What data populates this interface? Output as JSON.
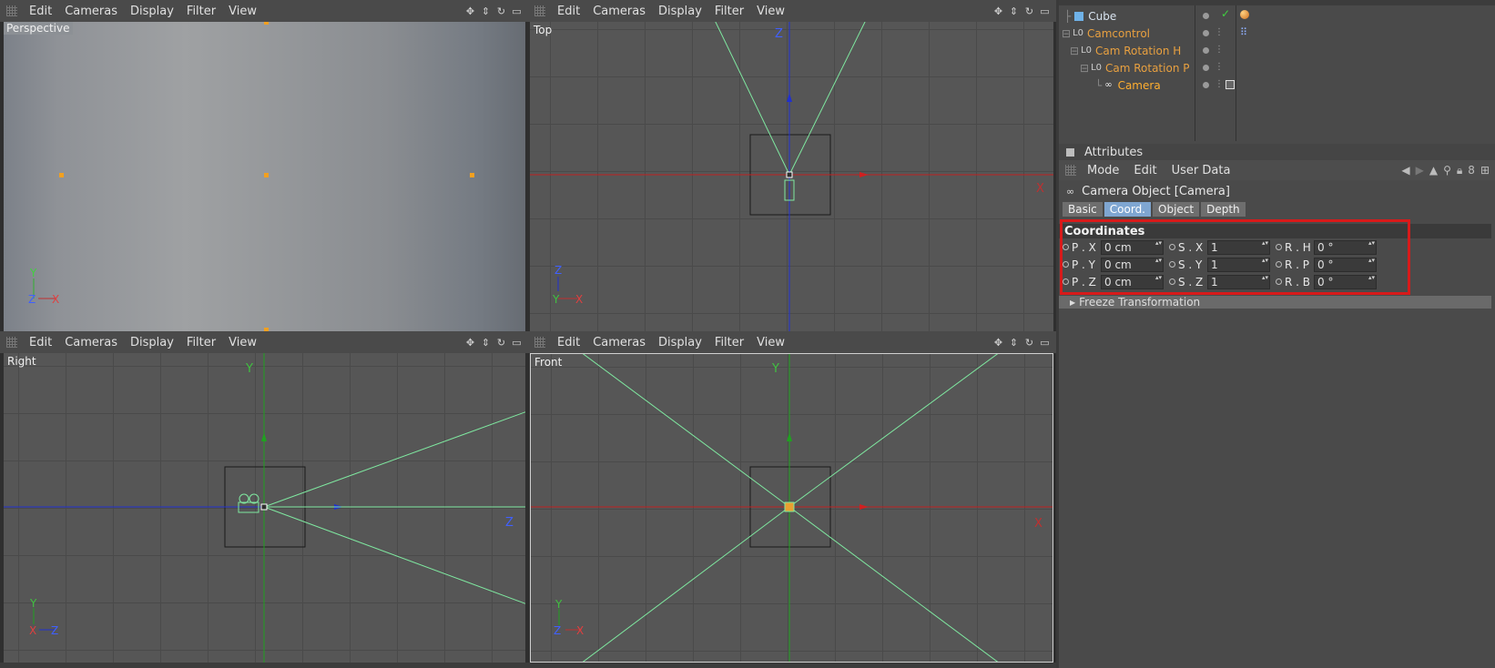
{
  "viewports": {
    "perspective": {
      "label": "Perspective",
      "menu": [
        "Edit",
        "Cameras",
        "Display",
        "Filter",
        "View"
      ],
      "axes": {
        "y": "Y",
        "z": "Z",
        "x": "X"
      }
    },
    "top": {
      "label": "Top",
      "menu": [
        "Edit",
        "Cameras",
        "Display",
        "Filter",
        "View"
      ],
      "axis_a": "Z",
      "axis_b": "X",
      "axes": {
        "z": "Z",
        "y": "Y",
        "x": "X"
      }
    },
    "right": {
      "label": "Right",
      "menu": [
        "Edit",
        "Cameras",
        "Display",
        "Filter",
        "View"
      ],
      "axis_a": "Y",
      "axis_b": "Z",
      "axes": {
        "y": "Y",
        "x": "X",
        "z": "Z"
      }
    },
    "front": {
      "label": "Front",
      "menu": [
        "Edit",
        "Cameras",
        "Display",
        "Filter",
        "View"
      ],
      "axis_a": "Y",
      "axis_b": "X",
      "axes": {
        "y": "Y",
        "z": "Z",
        "x": "X"
      }
    }
  },
  "object_manager": {
    "items": [
      {
        "name": "Cube",
        "style": "blue"
      },
      {
        "name": "Camcontrol",
        "style": "orange"
      },
      {
        "name": "Cam Rotation H",
        "style": "orange"
      },
      {
        "name": "Cam Rotation P",
        "style": "orange"
      },
      {
        "name": "Camera",
        "style": "active"
      }
    ]
  },
  "attributes": {
    "title": "Attributes",
    "menu": [
      "Mode",
      "Edit",
      "User Data"
    ],
    "object_header": "Camera Object [Camera]",
    "tabs": [
      {
        "label": "Basic",
        "active": false
      },
      {
        "label": "Coord.",
        "active": true
      },
      {
        "label": "Object",
        "active": false
      },
      {
        "label": "Depth",
        "active": false
      }
    ],
    "section": "Coordinates",
    "rows": [
      [
        {
          "label": "P . X",
          "value": "0 cm"
        },
        {
          "label": "S . X",
          "value": "1"
        },
        {
          "label": "R . H",
          "value": "0 °"
        }
      ],
      [
        {
          "label": "P . Y",
          "value": "0 cm"
        },
        {
          "label": "S . Y",
          "value": "1"
        },
        {
          "label": "R . P",
          "value": "0 °"
        }
      ],
      [
        {
          "label": "P . Z",
          "value": "0 cm"
        },
        {
          "label": "S . Z",
          "value": "1"
        },
        {
          "label": "R . B",
          "value": "0 °"
        }
      ]
    ],
    "freeze": "Freeze Transformation"
  },
  "colors": {
    "highlight": "#d81a1a",
    "x_axis": "#c02020",
    "y_axis": "#20a020",
    "z_axis": "#2030d0",
    "frustum": "#7fe8a0",
    "selection": "#ffae30"
  }
}
